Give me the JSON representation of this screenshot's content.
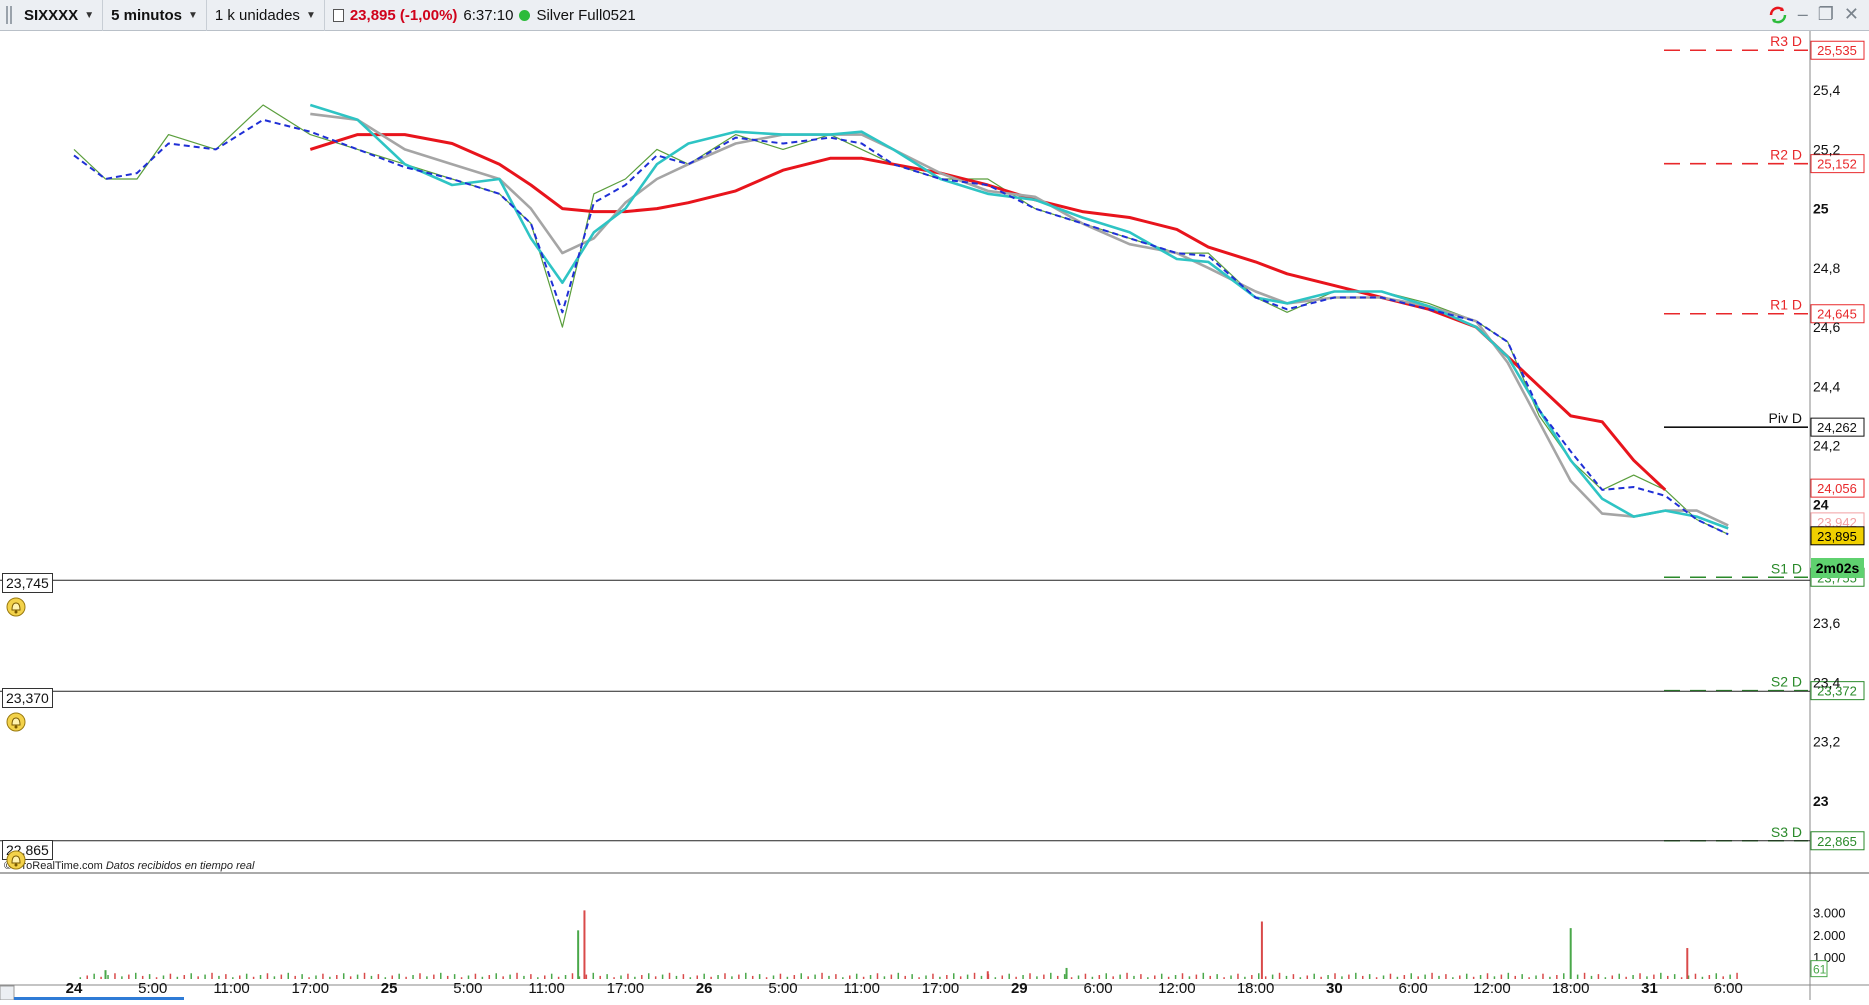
{
  "toolbar": {
    "symbol": "SIXXXX",
    "timeframe": "5 minutos",
    "units": "1 k unidades",
    "price": "23,895 (-1,00%)",
    "time": "6:37:10",
    "account": "Silver Full0521"
  },
  "credit": {
    "brand": "© ProRealTime.com",
    "note": "Datos recibidos en tiempo real"
  },
  "alerts": [
    {
      "label": "23,745"
    },
    {
      "label": "23,370"
    },
    {
      "label": "22,865"
    }
  ],
  "timer": "2m02s",
  "chart_data": {
    "type": "line",
    "price_axis_ticks": [
      "25,4",
      "25,2",
      "25",
      "24,8",
      "24,6",
      "24,4",
      "24,2",
      "24",
      "23,6",
      "23,4",
      "23,2",
      "23"
    ],
    "price_axis_values": [
      25.4,
      25.2,
      25.0,
      24.8,
      24.6,
      24.4,
      24.2,
      24.0,
      23.6,
      23.4,
      23.2,
      23.0
    ],
    "ylim": [
      22.8,
      25.6
    ],
    "pivots": [
      {
        "name": "R3 D",
        "value": "25,535",
        "color": "#e8282b",
        "style": "dashed"
      },
      {
        "name": "R2 D",
        "value": "25,152",
        "color": "#e8282b",
        "style": "dashed"
      },
      {
        "name": "R1 D",
        "value": "24,645",
        "color": "#e8282b",
        "style": "dashed"
      },
      {
        "name": "Piv D",
        "value": "24,262",
        "color": "#111111",
        "style": "solid"
      },
      {
        "name": "S1 D",
        "value": "23,755",
        "color": "#2a8a2a",
        "style": "dashed"
      },
      {
        "name": "S2 D",
        "value": "23,372",
        "color": "#2a8a2a",
        "style": "dashed"
      },
      {
        "name": "S3 D",
        "value": "22,865",
        "color": "#2a8a2a",
        "style": "dashed"
      }
    ],
    "price_labels": [
      {
        "value": "24,056",
        "color": "#e8282b",
        "bg": "#ffffff"
      },
      {
        "value": "23,942",
        "color": "#f2a1a3",
        "bg": "#ffffff"
      },
      {
        "value": "23,895",
        "color": "#000000",
        "bg": "#f0d000"
      }
    ],
    "x_axis_labels": [
      {
        "label": "24",
        "bold": true,
        "x": 0.0
      },
      {
        "label": "5:00",
        "bold": false,
        "x": 0.25
      },
      {
        "label": "11:00",
        "bold": false,
        "x": 0.5
      },
      {
        "label": "17:00",
        "bold": false,
        "x": 0.75
      },
      {
        "label": "25",
        "bold": true,
        "x": 1.0
      },
      {
        "label": "5:00",
        "bold": false,
        "x": 1.25
      },
      {
        "label": "11:00",
        "bold": false,
        "x": 1.5
      },
      {
        "label": "17:00",
        "bold": false,
        "x": 1.75
      },
      {
        "label": "26",
        "bold": true,
        "x": 2.0
      },
      {
        "label": "5:00",
        "bold": false,
        "x": 2.25
      },
      {
        "label": "11:00",
        "bold": false,
        "x": 2.5
      },
      {
        "label": "17:00",
        "bold": false,
        "x": 2.75
      },
      {
        "label": "29",
        "bold": true,
        "x": 3.0
      },
      {
        "label": "6:00",
        "bold": false,
        "x": 3.25
      },
      {
        "label": "12:00",
        "bold": false,
        "x": 3.5
      },
      {
        "label": "18:00",
        "bold": false,
        "x": 3.75
      },
      {
        "label": "30",
        "bold": true,
        "x": 4.0
      },
      {
        "label": "6:00",
        "bold": false,
        "x": 4.25
      },
      {
        "label": "12:00",
        "bold": false,
        "x": 4.5
      },
      {
        "label": "18:00",
        "bold": false,
        "x": 4.75
      },
      {
        "label": "31",
        "bold": true,
        "x": 5.0
      },
      {
        "label": "6:00",
        "bold": false,
        "x": 5.25
      }
    ],
    "series": [
      {
        "name": "price",
        "color": "#5a9e3c",
        "x": [
          0,
          0.1,
          0.2,
          0.3,
          0.45,
          0.6,
          0.75,
          0.9,
          1.05,
          1.2,
          1.35,
          1.45,
          1.55,
          1.65,
          1.75,
          1.85,
          1.95,
          2.1,
          2.25,
          2.4,
          2.5,
          2.6,
          2.75,
          2.9,
          3.05,
          3.2,
          3.35,
          3.5,
          3.6,
          3.75,
          3.85,
          4.0,
          4.15,
          4.3,
          4.45,
          4.55,
          4.65,
          4.75,
          4.85,
          4.95,
          5.05,
          5.15,
          5.25
        ],
        "y": [
          25.2,
          25.1,
          25.1,
          25.25,
          25.2,
          25.35,
          25.25,
          25.2,
          25.15,
          25.1,
          25.05,
          24.95,
          24.6,
          25.05,
          25.1,
          25.2,
          25.15,
          25.25,
          25.2,
          25.25,
          25.2,
          25.15,
          25.1,
          25.1,
          25.0,
          24.95,
          24.9,
          24.85,
          24.85,
          24.7,
          24.65,
          24.72,
          24.72,
          24.68,
          24.62,
          24.55,
          24.3,
          24.15,
          24.05,
          24.1,
          24.05,
          23.95,
          23.9
        ]
      },
      {
        "name": "ma-red",
        "color": "#e8141c",
        "x": [
          0.75,
          0.9,
          1.05,
          1.2,
          1.35,
          1.45,
          1.55,
          1.65,
          1.75,
          1.85,
          1.95,
          2.1,
          2.25,
          2.4,
          2.5,
          2.6,
          2.75,
          2.9,
          3.05,
          3.2,
          3.35,
          3.5,
          3.6,
          3.75,
          3.85,
          4.0,
          4.15,
          4.3,
          4.45,
          4.55,
          4.65,
          4.75,
          4.85,
          4.95,
          5.05
        ],
        "y": [
          25.2,
          25.25,
          25.25,
          25.22,
          25.15,
          25.08,
          25.0,
          24.99,
          24.99,
          25.0,
          25.02,
          25.06,
          25.13,
          25.17,
          25.17,
          25.15,
          25.12,
          25.08,
          25.03,
          24.99,
          24.97,
          24.93,
          24.87,
          24.82,
          24.78,
          24.74,
          24.7,
          24.66,
          24.6,
          24.5,
          24.4,
          24.3,
          24.28,
          24.15,
          24.05
        ]
      },
      {
        "name": "ma-gray",
        "color": "#a5a5a5",
        "x": [
          0.75,
          0.9,
          1.05,
          1.2,
          1.35,
          1.45,
          1.55,
          1.65,
          1.75,
          1.85,
          1.95,
          2.1,
          2.25,
          2.4,
          2.5,
          2.6,
          2.75,
          2.9,
          3.05,
          3.2,
          3.35,
          3.5,
          3.6,
          3.75,
          3.85,
          4.0,
          4.15,
          4.3,
          4.45,
          4.55,
          4.65,
          4.75,
          4.85,
          4.95,
          5.05,
          5.15,
          5.25
        ],
        "y": [
          25.32,
          25.3,
          25.2,
          25.15,
          25.1,
          25.0,
          24.85,
          24.9,
          25.02,
          25.1,
          25.15,
          25.22,
          25.25,
          25.25,
          25.25,
          25.2,
          25.12,
          25.06,
          25.04,
          24.95,
          24.88,
          24.85,
          24.8,
          24.72,
          24.68,
          24.7,
          24.7,
          24.67,
          24.62,
          24.48,
          24.28,
          24.08,
          23.97,
          23.96,
          23.98,
          23.98,
          23.93
        ]
      },
      {
        "name": "ma-cyan",
        "color": "#2ec4c4",
        "x": [
          0.75,
          0.9,
          1.05,
          1.2,
          1.35,
          1.45,
          1.55,
          1.65,
          1.75,
          1.85,
          1.95,
          2.1,
          2.25,
          2.4,
          2.5,
          2.6,
          2.75,
          2.9,
          3.05,
          3.2,
          3.35,
          3.5,
          3.6,
          3.75,
          3.85,
          4.0,
          4.15,
          4.3,
          4.45,
          4.55,
          4.65,
          4.75,
          4.85,
          4.95,
          5.05,
          5.15,
          5.25
        ],
        "y": [
          25.35,
          25.3,
          25.15,
          25.08,
          25.1,
          24.9,
          24.75,
          24.92,
          25.0,
          25.15,
          25.22,
          25.26,
          25.25,
          25.25,
          25.26,
          25.2,
          25.1,
          25.05,
          25.03,
          24.97,
          24.92,
          24.83,
          24.82,
          24.7,
          24.68,
          24.72,
          24.72,
          24.67,
          24.6,
          24.5,
          24.32,
          24.15,
          24.02,
          23.96,
          23.98,
          23.96,
          23.92
        ]
      },
      {
        "name": "ma-blue-dashed",
        "color": "#1f2fd6",
        "x": [
          0,
          0.1,
          0.2,
          0.3,
          0.45,
          0.6,
          0.75,
          0.9,
          1.05,
          1.2,
          1.35,
          1.45,
          1.55,
          1.65,
          1.75,
          1.85,
          1.95,
          2.1,
          2.25,
          2.4,
          2.5,
          2.6,
          2.75,
          2.9,
          3.05,
          3.2,
          3.35,
          3.5,
          3.6,
          3.75,
          3.85,
          4.0,
          4.15,
          4.3,
          4.45,
          4.55,
          4.65,
          4.75,
          4.85,
          4.95,
          5.05,
          5.15,
          5.25
        ],
        "y": [
          25.18,
          25.1,
          25.12,
          25.22,
          25.2,
          25.3,
          25.26,
          25.2,
          25.14,
          25.1,
          25.05,
          24.95,
          24.65,
          25.02,
          25.08,
          25.18,
          25.15,
          25.24,
          25.22,
          25.24,
          25.22,
          25.15,
          25.1,
          25.08,
          25.0,
          24.95,
          24.9,
          24.85,
          24.84,
          24.7,
          24.66,
          24.7,
          24.7,
          24.66,
          24.62,
          24.55,
          24.32,
          24.18,
          24.05,
          24.06,
          24.03,
          23.95,
          23.9
        ]
      }
    ],
    "volume": {
      "axis_ticks": [
        "3.000",
        "2.000",
        "1.000"
      ],
      "axis_values": [
        3000,
        2000,
        1000
      ],
      "current": "61",
      "spikes": [
        {
          "x": 1.62,
          "value": 3100
        },
        {
          "x": 1.6,
          "value": 2200
        },
        {
          "x": 3.77,
          "value": 2600
        },
        {
          "x": 4.75,
          "value": 2300
        },
        {
          "x": 5.12,
          "value": 1400
        },
        {
          "x": 0.1,
          "value": 400
        },
        {
          "x": 2.9,
          "value": 350
        },
        {
          "x": 3.15,
          "value": 500
        }
      ]
    }
  }
}
